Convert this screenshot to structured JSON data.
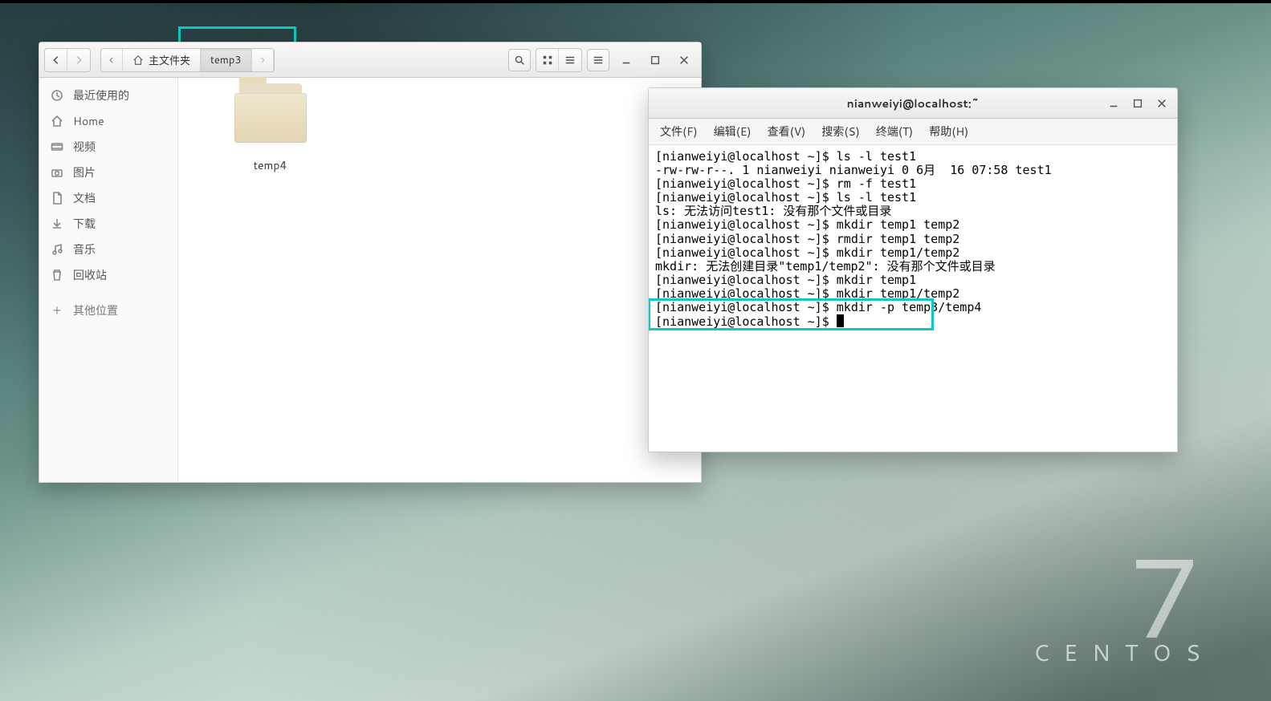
{
  "centos": {
    "seven": "7",
    "name": "CENTOS"
  },
  "fm": {
    "path": {
      "home": "主文件夹",
      "current": "temp3"
    },
    "sidebar": [
      {
        "key": "recent",
        "label": "最近使用的"
      },
      {
        "key": "home",
        "label": "Home"
      },
      {
        "key": "videos",
        "label": "视频"
      },
      {
        "key": "pictures",
        "label": "图片"
      },
      {
        "key": "documents",
        "label": "文档"
      },
      {
        "key": "downloads",
        "label": "下载"
      },
      {
        "key": "music",
        "label": "音乐"
      },
      {
        "key": "trash",
        "label": "回收站"
      }
    ],
    "other_places": "其他位置",
    "folder": {
      "name": "temp4"
    }
  },
  "term": {
    "title": "nianweiyi@localhost:~",
    "menus": {
      "file": "文件(F)",
      "edit": "编辑(E)",
      "view": "查看(V)",
      "search": "搜索(S)",
      "terminal": "终端(T)",
      "help": "帮助(H)"
    },
    "lines": [
      "[nianweiyi@localhost ~]$ ls -l test1",
      "-rw-rw-r--. 1 nianweiyi nianweiyi 0 6月  16 07:58 test1",
      "[nianweiyi@localhost ~]$ rm -f test1",
      "[nianweiyi@localhost ~]$ ls -l test1",
      "ls: 无法访问test1: 没有那个文件或目录",
      "[nianweiyi@localhost ~]$ mkdir temp1 temp2",
      "[nianweiyi@localhost ~]$ rmdir temp1 temp2",
      "[nianweiyi@localhost ~]$ mkdir temp1/temp2",
      "mkdir: 无法创建目录\"temp1/temp2\": 没有那个文件或目录",
      "[nianweiyi@localhost ~]$ mkdir temp1",
      "[nianweiyi@localhost ~]$ mkdir temp1/temp2",
      "[nianweiyi@localhost ~]$ mkdir -p temp3/temp4"
    ],
    "prompt": "[nianweiyi@localhost ~]$ "
  }
}
